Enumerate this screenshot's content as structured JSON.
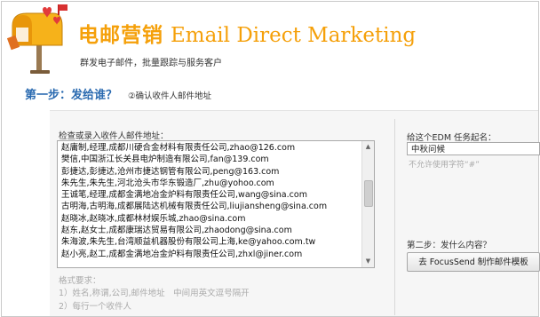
{
  "header": {
    "title_cn": "电邮营销",
    "title_en": "Email Direct Marketing",
    "subtitle": "群发电子邮件，批量跟踪与服务客户"
  },
  "step1": {
    "title": "第一步：发给谁？",
    "subtitle": "②确认收件人邮件地址"
  },
  "recipients": {
    "label": "检查或录入收件人邮件地址：",
    "rows": [
      "赵庸制,经理,成都川硬合金材料有限责任公司,zhao@126.com",
      "樊信,中国浙江长关县电炉制造有限公司,fan@139.com",
      "彭捷达,彭捷达,沧州市捷达钢管有限公司,peng@163.com",
      "朱先生,朱先生,河北沧头市华东锻造厂,zhu@yohoo.com",
      "王诚笔,经理,成都金满地冶金炉料有限责任公司,wang@sina.com",
      "古明海,古明海,成都展陆达机械有限责任公司,liujiansheng@sina.com",
      "赵晓冰,赵晓冰,成都林材娱乐城,zhao@sina.com",
      "赵东,赵女士,成都康瑞达贸易有限公司,zhaodong@sina.com",
      "朱海波,朱先生,台湾顺益机器股份有限公司上海,ke@yahoo.com.tw",
      "赵小亮,赵工,成都金满地冶金炉料有限责任公司,zhxl@jiner.com"
    ],
    "format_title": "格式要求：",
    "format_line1": "1）姓名,称谓,公司,邮件地址　中间用英文逗号隔开",
    "format_line2": "2）每行一个收件人"
  },
  "task": {
    "label": "给这个EDM 任务起名：",
    "value": "中秋问候",
    "hint": "不允许使用字符“#”"
  },
  "step2": {
    "title": "第二步：发什么内容？",
    "button": "去 FocusSend 制作邮件模板"
  }
}
